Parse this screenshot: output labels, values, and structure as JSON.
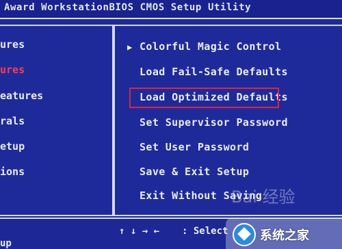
{
  "title": "Award WorkstationBIOS CMOS Setup Utility",
  "left_menu": [
    {
      "label": "ures",
      "active": false
    },
    {
      "label": "ures",
      "active": true
    },
    {
      "label": "eatures",
      "active": false
    },
    {
      "label": "rals",
      "active": false
    },
    {
      "label": "etup",
      "active": false
    },
    {
      "label": "ions",
      "active": false
    }
  ],
  "right_menu": {
    "submenu_arrow": "▶",
    "items": [
      {
        "label": "Colorful Magic Control",
        "has_submenu": true
      },
      {
        "label": "Load Fail-Safe Defaults"
      },
      {
        "label": "Load Optimized Defaults",
        "highlighted": true
      },
      {
        "label": "Set Supervisor Password"
      },
      {
        "label": "Set User Password"
      },
      {
        "label": "Save & Exit Setup"
      },
      {
        "label": "Exit Without Saving"
      }
    ]
  },
  "footer": {
    "keys": "↑ ↓ → ←",
    "select_label": ": Select",
    "bottom_left": "up"
  },
  "watermark": {
    "text": "系统之家",
    "faint_text": "Bai 经验"
  },
  "colors": {
    "background": "#1f2a9a",
    "text": "#e8edf2",
    "active_item": "#ff3c4a",
    "highlight_box": "#e0243a"
  }
}
